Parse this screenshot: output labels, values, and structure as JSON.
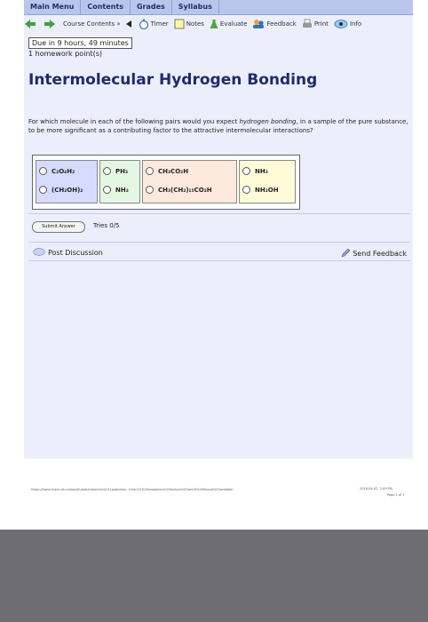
{
  "menu": [
    "Main Menu",
    "Contents",
    "Grades",
    "Syllabus"
  ],
  "toolbar": {
    "course_contents": "Course Contents »",
    "timer": "Timer",
    "notes": "Notes",
    "evaluate": "Evaluate",
    "feedback": "Feedback",
    "print": "Print",
    "info": "Info"
  },
  "due": "Due in 9 hours, 49 minutes",
  "points": "1 homework point(s)",
  "title": "Intermolecular Hydrogen Bonding",
  "question": {
    "part1": "For which molecule in each of the following pairs would you expect ",
    "emphasis": "hydrogen bonding",
    "part2": ", in a sample of the pure substance, to be more significant as a contributing factor to the attractive intermolecular interactions?"
  },
  "pairs": [
    {
      "a": "C₂O₄H₂",
      "b": "(CH₂OH)₂",
      "color": "#d7dcff"
    },
    {
      "a": "PH₃",
      "b": "NH₃",
      "color": "#e3f7e3"
    },
    {
      "a": "CH₃CO₂H",
      "b": "CH₃(CH₂)₁₅CO₂H",
      "color": "#fde9dc"
    },
    {
      "a": "NH₃",
      "b": "NH₂OH",
      "color": "#fffbd8"
    }
  ],
  "submit_label": "Submit Answer",
  "tries": "Tries 0/5",
  "post_discussion": "Post Discussion",
  "send_feedback": "Send Feedback",
  "footer": {
    "url": "https://lewis.chem.sfu.ca/res/sfu/batchelo/chem121problems...hem121%20problems%20lecture%20set10%20hbond%20problem",
    "date": "2016-04-02, 2:09 PM",
    "page": "Page 1 of 1"
  }
}
